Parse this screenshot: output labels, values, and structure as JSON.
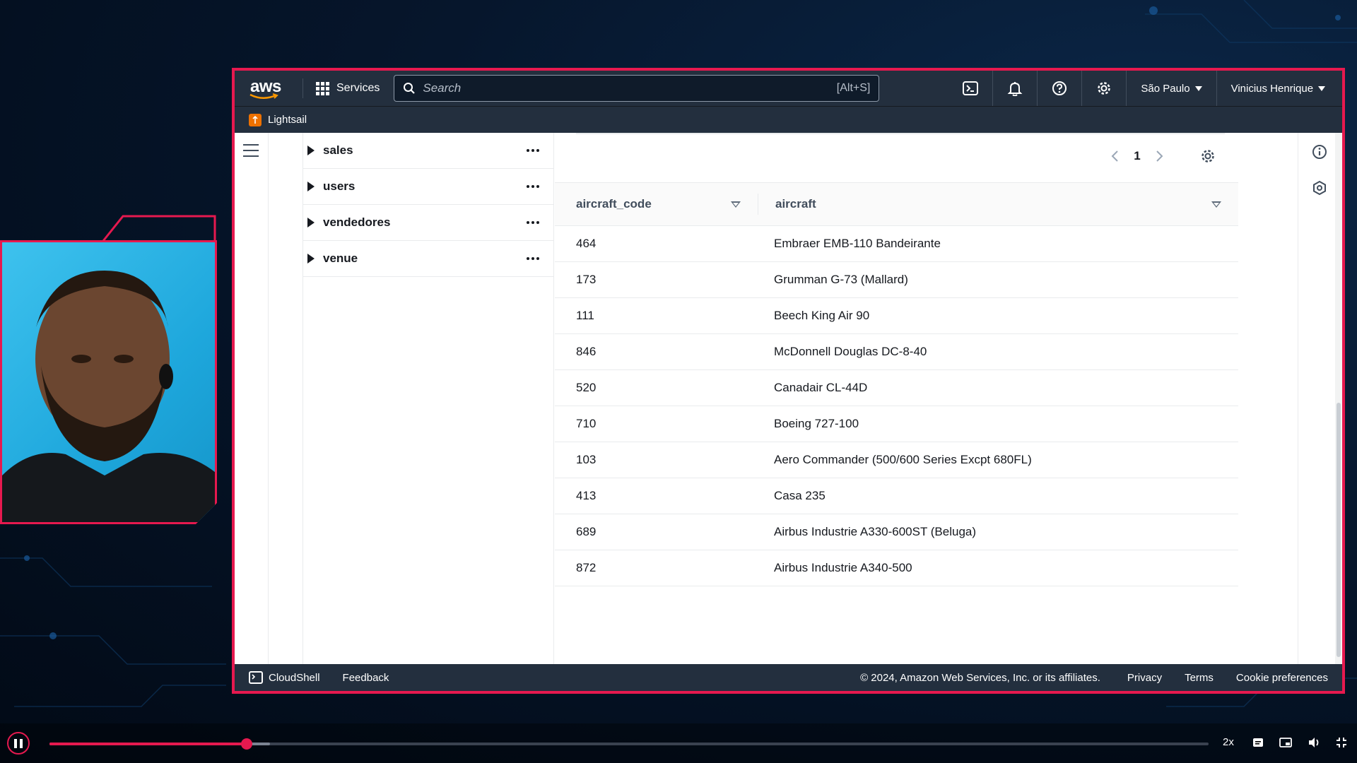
{
  "console": {
    "logo_text": "aws",
    "services_label": "Services",
    "search_placeholder": "Search",
    "search_shortcut": "[Alt+S]",
    "region": "São Paulo",
    "user": "Vinicius Henrique",
    "service_name": "Lightsail"
  },
  "tree": {
    "items": [
      {
        "label": "sales"
      },
      {
        "label": "users"
      },
      {
        "label": "vendedores"
      },
      {
        "label": "venue"
      }
    ]
  },
  "results": {
    "page": "1",
    "columns": [
      "aircraft_code",
      "aircraft"
    ],
    "rows": [
      [
        "464",
        "Embraer EMB-110 Bandeirante"
      ],
      [
        "173",
        "Grumman G-73 (Mallard)"
      ],
      [
        "111",
        "Beech King Air 90"
      ],
      [
        "846",
        "McDonnell Douglas DC-8-40"
      ],
      [
        "520",
        "Canadair CL-44D"
      ],
      [
        "710",
        "Boeing 727-100"
      ],
      [
        "103",
        "Aero Commander (500/600 Series Excpt 680FL)"
      ],
      [
        "413",
        "Casa 235"
      ],
      [
        "689",
        "Airbus Industrie A330-600ST (Beluga)"
      ],
      [
        "872",
        "Airbus Industrie A340-500"
      ]
    ]
  },
  "footer": {
    "cloudshell": "CloudShell",
    "feedback": "Feedback",
    "copyright": "© 2024, Amazon Web Services, Inc. or its affiliates.",
    "privacy": "Privacy",
    "terms": "Terms",
    "cookies": "Cookie preferences"
  },
  "player": {
    "speed": "2x",
    "progress": 0.17,
    "buffered": 0.19
  },
  "colors": {
    "accent": "#e6194f",
    "nav_bg": "#232f3e",
    "lightsail": "#ed7100"
  }
}
